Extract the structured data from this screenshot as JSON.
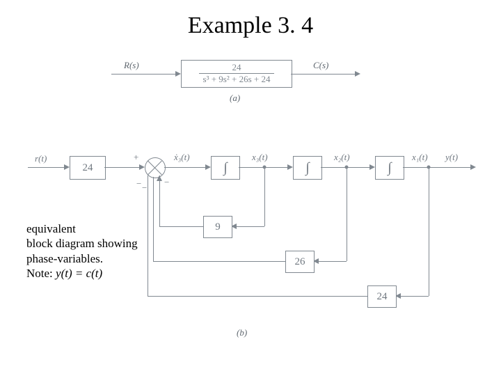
{
  "title": "Example 3. 4",
  "caption": {
    "l1": "equivalent",
    "l2": "block diagram showing",
    "l3": "phase-variables.",
    "l4a": "Note: ",
    "l4b": "y(t) = c(t)"
  },
  "diagramA": {
    "input": "R(s)",
    "output": "C(s)",
    "tf_num": "24",
    "tf_den": "s³ + 9s² + 26s + 24",
    "tag": "(a)"
  },
  "diagramB": {
    "input": "r(t)",
    "gain_in": "24",
    "sum_plus": "+",
    "sum_minus1": "−",
    "sum_minus2": "−",
    "sum_minus3": "−",
    "x3dot": "ẋ₃(t)",
    "x3": "x₃(t)",
    "x2": "x₂(t)",
    "x1": "x₁(t)",
    "y": "y(t)",
    "int": "∫",
    "fb1": "9",
    "fb2": "26",
    "fb3": "24",
    "tag": "(b)"
  }
}
